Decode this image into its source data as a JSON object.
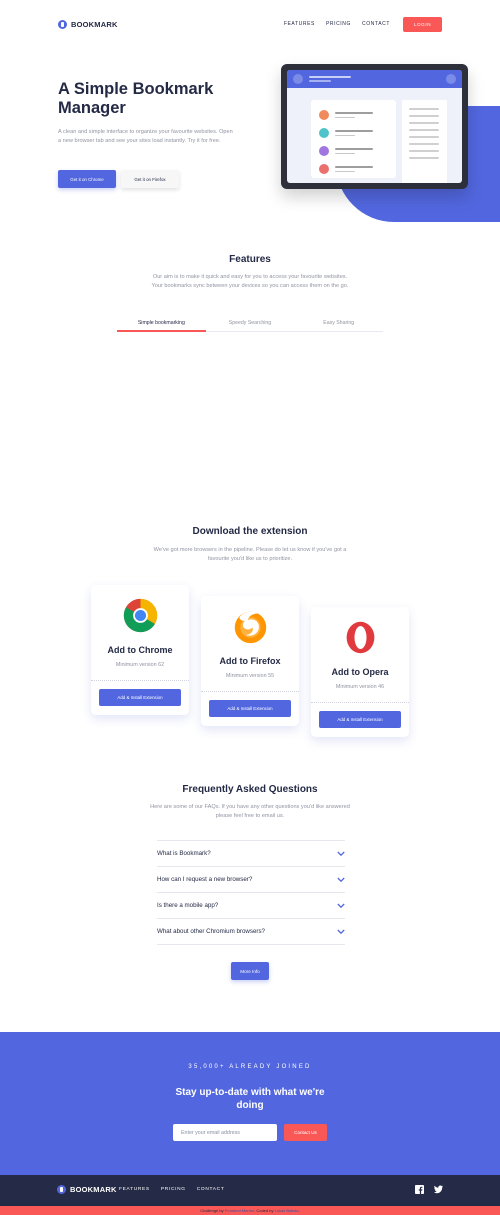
{
  "colors": {
    "primary": "#5267DF",
    "accent": "#FA5757",
    "dark": "#242A45",
    "grey": "#9194A2"
  },
  "header": {
    "logo_text": "BOOKMARK",
    "nav": [
      "FEATURES",
      "PRICING",
      "CONTACT"
    ],
    "login_label": "LOGIN"
  },
  "hero": {
    "title": "A Simple Bookmark Manager",
    "description": "A clean and simple interface to organize your favourite websites. Open a new browser tab and see your sites load instantly. Try it for free.",
    "chrome_button": "Get it on Chrome",
    "firefox_button": "Get it on Firefox"
  },
  "features": {
    "title": "Features",
    "description": "Our aim is to make it quick and easy for you to access your favourite websites. Your bookmarks sync between your devices so you can access them on the go.",
    "tabs": [
      "Simple bookmarking",
      "Speedy Searching",
      "Easy Sharing"
    ],
    "active_tab": 0
  },
  "download": {
    "title": "Download the extension",
    "description": "We've got more browsers in the pipeline. Please do let us know if you've got a favourite you'd like us to prioritize.",
    "cards": [
      {
        "name": "Add to Chrome",
        "min": "Minimum version 62",
        "button": "Add & Install Extension",
        "icon": "chrome-icon"
      },
      {
        "name": "Add to Firefox",
        "min": "Minimum version 55",
        "button": "Add & Install Extension",
        "icon": "firefox-icon"
      },
      {
        "name": "Add to Opera",
        "min": "Minimum version 46",
        "button": "Add & Install Extension",
        "icon": "opera-icon"
      }
    ]
  },
  "faq": {
    "title": "Frequently Asked Questions",
    "description": "Here are some of our FAQs. If you have any other questions you'd like answered please feel free to email us.",
    "questions": [
      "What is Bookmark?",
      "How can I request a new browser?",
      "Is there a mobile app?",
      "What about other Chromium browsers?"
    ],
    "more_button": "More Info"
  },
  "cta": {
    "kicker": "35,000+ ALREADY JOINED",
    "title": "Stay up-to-date with what we're doing",
    "email_placeholder": "Enter your email address",
    "button": "Contact Us"
  },
  "footer": {
    "logo_text": "BOOKMARK",
    "nav": [
      "FEATURES",
      "PRICING",
      "CONTACT"
    ],
    "social": [
      "facebook-icon",
      "twitter-icon"
    ]
  },
  "attribution": {
    "prefix": "Challenge by",
    "mentor": "Frontend Mentor",
    "middle": ". Coded by",
    "author": "Lukas Batista",
    "suffix": "."
  }
}
